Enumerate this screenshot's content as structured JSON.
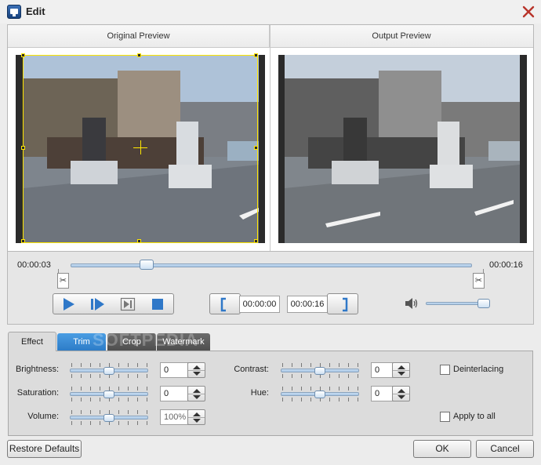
{
  "window": {
    "title": "Edit"
  },
  "preview": {
    "original_label": "Original Preview",
    "output_label": "Output Preview"
  },
  "timeline": {
    "current_time": "00:00:03",
    "end_time": "00:00:16",
    "seek_position_fraction": 0.19,
    "volume_fraction": 0.9,
    "trim_start": "00:00:00",
    "trim_end": "00:00:16",
    "start_marker_glyph": "✂",
    "end_marker_glyph": "✂"
  },
  "tabs": [
    {
      "label": "Effect",
      "active": true
    },
    {
      "label": "Trim",
      "active": false
    },
    {
      "label": "Crop",
      "active": false
    },
    {
      "label": "Watermark",
      "active": false
    }
  ],
  "watermark_text": "SOFTPEDIA",
  "effects": {
    "brightness": {
      "label": "Brightness:",
      "value": "0"
    },
    "saturation": {
      "label": "Saturation:",
      "value": "0"
    },
    "volume": {
      "label": "Volume:",
      "value": "100%"
    },
    "contrast": {
      "label": "Contrast:",
      "value": "0"
    },
    "hue": {
      "label": "Hue:",
      "value": "0"
    },
    "deinterlacing": {
      "label": "Deinterlacing",
      "checked": false
    },
    "apply_all": {
      "label": "Apply to all",
      "checked": false
    }
  },
  "buttons": {
    "restore": "Restore Defaults",
    "ok": "OK",
    "cancel": "Cancel"
  },
  "icons": {
    "app": "video-edit-icon",
    "close": "close-icon",
    "play": "play-icon",
    "step": "step-forward-icon",
    "next": "next-frame-icon",
    "stop": "stop-icon",
    "speaker": "speaker-icon"
  },
  "colors": {
    "accent_tab": "#2c7bc6",
    "crop_box": "#ffe600",
    "close_x": "#b8342a",
    "icon_blue": "#2f78c8"
  }
}
